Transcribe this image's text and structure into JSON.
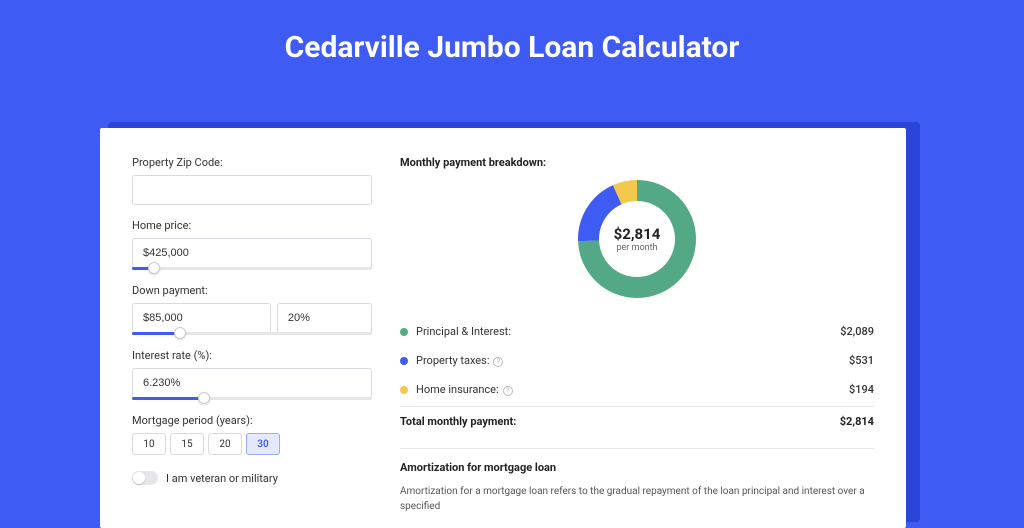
{
  "page_title": "Cedarville Jumbo Loan Calculator",
  "form": {
    "zip_label": "Property Zip Code:",
    "zip_value": "",
    "home_price_label": "Home price:",
    "home_price_value": "$425,000",
    "home_price_slider_pos": 9,
    "down_payment_label": "Down payment:",
    "down_payment_value": "$85,000",
    "down_payment_pct": "20%",
    "down_payment_slider_pos": 20,
    "interest_label": "Interest rate (%):",
    "interest_value": "6.230%",
    "interest_slider_pos": 30,
    "period_label": "Mortgage period (years):",
    "period_options": [
      "10",
      "15",
      "20",
      "30"
    ],
    "period_selected": "30",
    "veteran_label": "I am veteran or military"
  },
  "breakdown": {
    "title": "Monthly payment breakdown:",
    "donut_value": "$2,814",
    "donut_sub": "per month",
    "items": [
      {
        "color": "#53a985",
        "label": "Principal & Interest:",
        "value": "$2,089",
        "info": false
      },
      {
        "color": "#3e5bf4",
        "label": "Property taxes:",
        "value": "$531",
        "info": true
      },
      {
        "color": "#f2c94c",
        "label": "Home insurance:",
        "value": "$194",
        "info": true
      }
    ],
    "total_label": "Total monthly payment:",
    "total_value": "$2,814"
  },
  "chart_data": {
    "type": "pie",
    "title": "Monthly payment breakdown",
    "series": [
      {
        "name": "Principal & Interest",
        "value": 2089,
        "color": "#53a985"
      },
      {
        "name": "Property taxes",
        "value": 531,
        "color": "#3e5bf4"
      },
      {
        "name": "Home insurance",
        "value": 194,
        "color": "#f2c94c"
      }
    ],
    "total": 2814,
    "center_label": "$2,814 per month"
  },
  "amortization": {
    "title": "Amortization for mortgage loan",
    "text": "Amortization for a mortgage loan refers to the gradual repayment of the loan principal and interest over a specified"
  }
}
